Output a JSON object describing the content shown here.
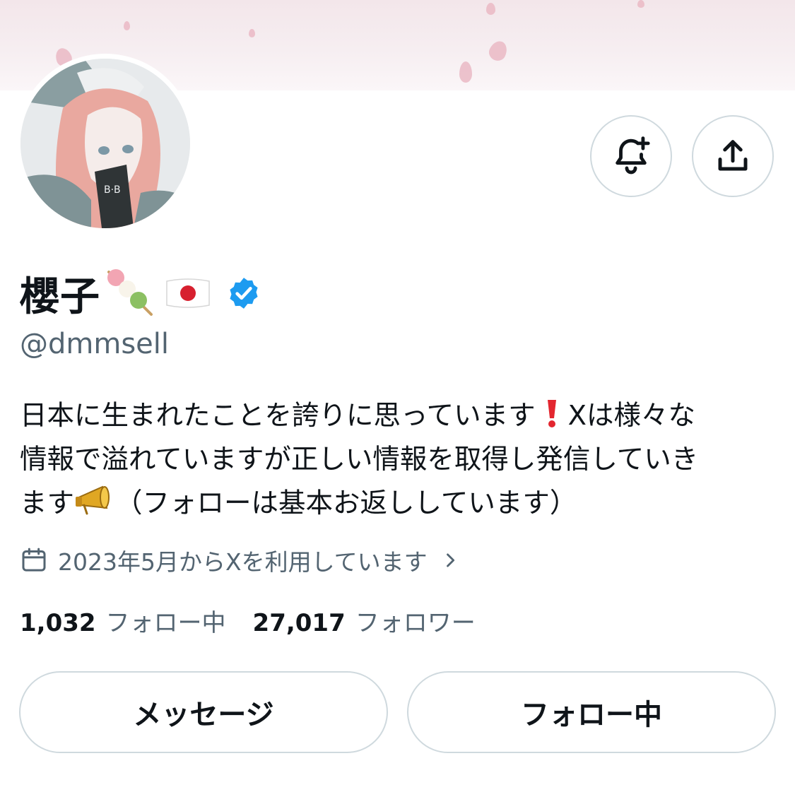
{
  "profile": {
    "display_name": "櫻子",
    "handle": "@dmmsell",
    "verified": true,
    "bio": {
      "line1": "日本に生まれたことを誇りに思っています",
      "line1_after": "Xは様々な",
      "line2": "情報で溢れていますが正しい情報を取得し発信していき",
      "line3_before": "ます",
      "line3_after": "（フォローは基本お返ししています）"
    },
    "joined": "2023年5月からXを利用しています",
    "following_count": "1,032",
    "following_label": "フォロー中",
    "followers_count": "27,017",
    "followers_label": "フォロワー"
  },
  "icons": {
    "notify": "bell-plus-icon",
    "share": "share-upload-icon",
    "calendar": "calendar-icon",
    "chevron": "chevron-right-icon",
    "verified": "verified-badge-icon",
    "dango": "dango-emoji",
    "flag": "japan-flag-emoji",
    "exclamation": "red-exclamation-emoji",
    "megaphone": "megaphone-emoji"
  },
  "actions": {
    "message_label": "メッセージ",
    "following_button_label": "フォロー中"
  },
  "colors": {
    "verified_blue": "#1d9bf0",
    "secondary_text": "#536471",
    "border": "#cfd9de",
    "banner_pink": "#f3e6ea"
  }
}
